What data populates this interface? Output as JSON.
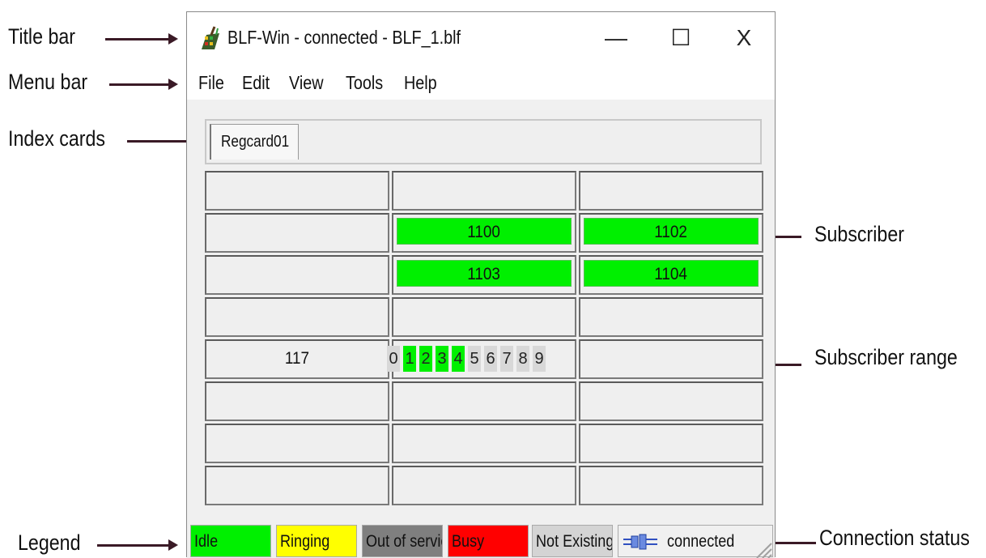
{
  "annotations": {
    "title_bar": "Title bar",
    "menu_bar": "Menu bar",
    "index_cards": "Index cards",
    "subscriber": "Subscriber",
    "subscriber_range": "Subscriber range",
    "legend": "Legend",
    "connection_status": "Connection status"
  },
  "window": {
    "title": "BLF-Win - connected - BLF_1.blf",
    "app_icon": "blf-app-icon",
    "controls": {
      "minimize": "—",
      "maximize": "☐",
      "close": "X"
    }
  },
  "menu": [
    "File",
    "Edit",
    "View",
    "Tools",
    "Help"
  ],
  "tabs": [
    "Regcard01"
  ],
  "grid": {
    "subscribers": {
      "r1c1": "1100",
      "r1c2": "1102",
      "r2c1": "1103",
      "r2c2": "1104"
    },
    "range": {
      "label": "117",
      "digits": [
        "0",
        "1",
        "2",
        "3",
        "4",
        "5",
        "6",
        "7",
        "8",
        "9"
      ],
      "active_digits": [
        "1",
        "2",
        "3",
        "4"
      ]
    }
  },
  "statusbar": {
    "legend": [
      {
        "label": "Idle",
        "color": "#00f000"
      },
      {
        "label": "Ringing",
        "color": "#ffff00"
      },
      {
        "label": "Out of service",
        "color": "#7f7f7f"
      },
      {
        "label": "Busy",
        "color": "#ff0000"
      },
      {
        "label": "Not Existing",
        "color": "#d4d4d4"
      }
    ],
    "connection": {
      "icon": "plug-icon",
      "text": "connected"
    }
  }
}
